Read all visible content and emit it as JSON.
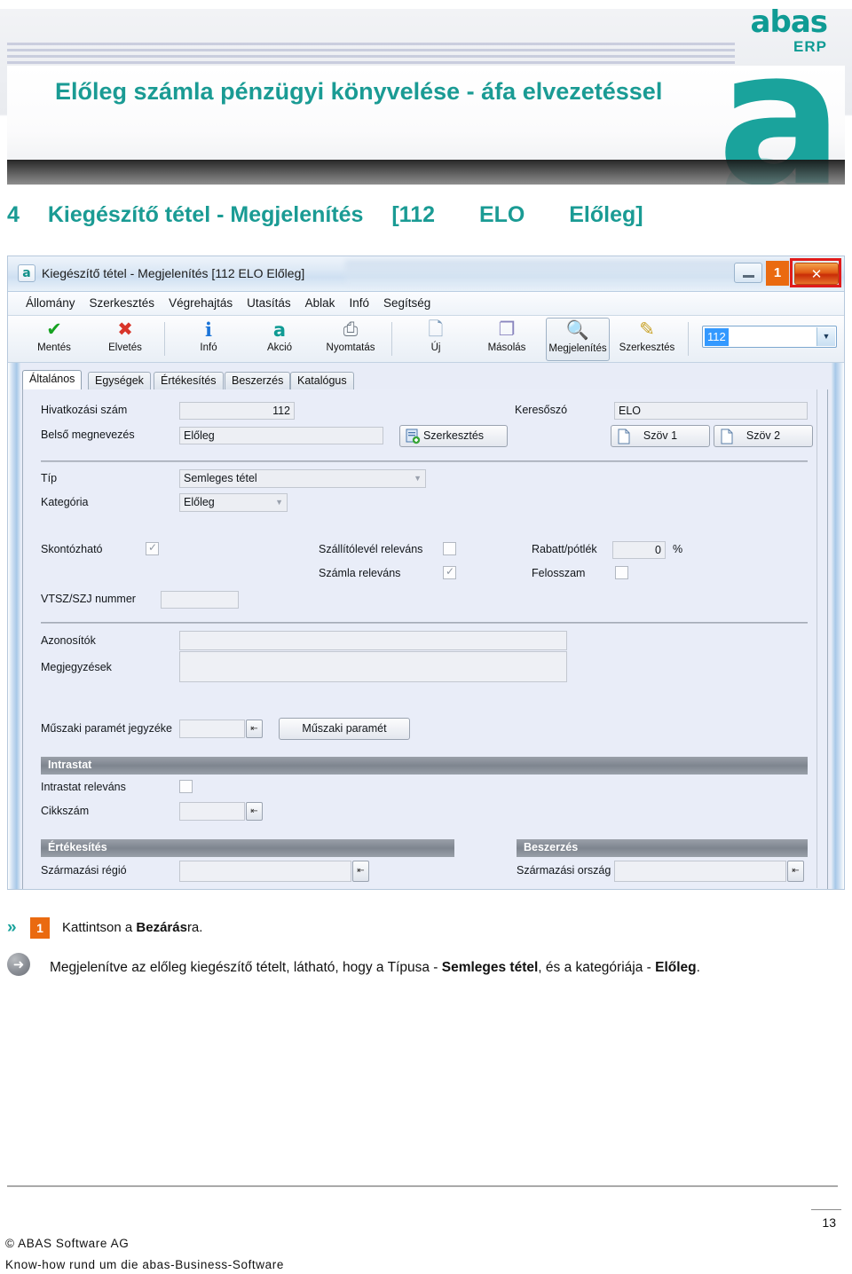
{
  "banner": {
    "logo_word": "abas",
    "logo_sub": "ERP",
    "title": "Előleg számla pénzügyi könyvelése - áfa elvezetéssel",
    "accent_color": "#1a9b94"
  },
  "section": {
    "heading_number": "4",
    "heading_text": "Kiegészítő tétel - Megjelenítés",
    "heading_ref1": "[112",
    "heading_ref2": "ELO",
    "heading_ref3": "Előleg]"
  },
  "window": {
    "title": "Kiegészítő tétel - Megjelenítés [112  ELO  Előleg]",
    "app_icon": "a",
    "minimize_label": "",
    "callout_badge": "1",
    "close_label": "✕",
    "menu": [
      "Állomány",
      "Szerkesztés",
      "Végrehajtás",
      "Utasítás",
      "Ablak",
      "Infó",
      "Segítség"
    ],
    "toolbar": [
      {
        "label": "Mentés",
        "icon": "check-icon",
        "glyph": "✔",
        "color": "#16a221",
        "selected": false
      },
      {
        "label": "Elvetés",
        "icon": "cross-icon",
        "glyph": "✖",
        "color": "#d8352a",
        "selected": false
      },
      {
        "label": "Infó",
        "icon": "info-icon",
        "glyph": "i",
        "color": "#1b74d8",
        "selected": false
      },
      {
        "label": "Akció",
        "icon": "abas-a-icon",
        "glyph": "a",
        "color": "#0f9b94",
        "selected": false
      },
      {
        "label": "Nyomtatás",
        "icon": "printer-icon",
        "glyph": "⎙",
        "color": "#707b86",
        "selected": false
      },
      {
        "label": "Új",
        "icon": "new-doc-icon",
        "glyph": "🗋",
        "color": "#8fa6bd",
        "selected": false
      },
      {
        "label": "Másolás",
        "icon": "copy-icon",
        "glyph": "❐",
        "color": "#8f8fbd",
        "selected": false
      },
      {
        "label": "Megjelenítés",
        "icon": "magnifier-icon",
        "glyph": "🔍",
        "color": "#4a78ad",
        "selected": true
      },
      {
        "label": "Szerkesztés",
        "icon": "edit-pencil-icon",
        "glyph": "✎",
        "color": "#c9a227",
        "selected": false
      }
    ],
    "quick_search_value": "112",
    "tabs": [
      {
        "label": "Általános",
        "active": true
      },
      {
        "label": "Egységek",
        "active": false
      },
      {
        "label": "Értékesítés",
        "active": false
      },
      {
        "label": "Beszerzés",
        "active": false
      },
      {
        "label": "Katalógus",
        "active": false
      }
    ],
    "form": {
      "hivatkozasi_szam_label": "Hivatkozási szám",
      "hivatkozasi_szam_value": "112",
      "belso_megnevezes_label": "Belső megnevezés",
      "belso_megnevezes_value": "Előleg",
      "szerkesztes_button": "Szerkesztés",
      "keresoszo_label": "Keresőszó",
      "keresoszo_value": "ELO",
      "szov1_button": "Szöv 1",
      "szov2_button": "Szöv 2",
      "tip_label": "Típ",
      "tip_value": "Semleges tétel",
      "kategoria_label": "Kategória",
      "kategoria_value": "Előleg",
      "skontozhato_label": "Skontózható",
      "skontozhato_checked": true,
      "szallitolevel_relevans_label": "Szállítólevél releváns",
      "szallitolevel_relevans_checked": false,
      "szamla_relevans_label": "Számla releváns",
      "szamla_relevans_checked": true,
      "rabatt_potlek_label": "Rabatt/pótlék",
      "rabatt_potlek_value": "0",
      "rabatt_potlek_unit": "%",
      "felosszam_label": "Felosszam",
      "felosszam_checked": false,
      "vtsz_label": "VTSZ/SZJ nummer",
      "vtsz_value": "",
      "azonositok_label": "Azonosítók",
      "azonositok_value": "",
      "megjegyzesek_label": "Megjegyzések",
      "megjegyzesek_value": "",
      "muszaki_jegyzek_label": "Műszaki paramét jegyzéke",
      "muszaki_jegyzek_value": "",
      "muszaki_button": "Műszaki paramét",
      "intrastat_group": "Intrastat",
      "intrastat_relevans_label": "Intrastat releváns",
      "intrastat_relevans_checked": false,
      "cikkszam_label": "Cikkszám",
      "cikkszam_value": "",
      "ertekesites_group": "Értékesítés",
      "szarmazasi_regio_label": "Származási régió",
      "szarmazasi_regio_value": "",
      "beszerzes_group": "Beszerzés",
      "szarmazasi_orszag_label": "Származási ország",
      "szarmazasi_orszag_value": ""
    }
  },
  "annotations": {
    "step_badge": "1",
    "step_chevron": "»",
    "step_text_a": "Kattintson  a  ",
    "step_text_b": "Bezárás",
    "step_text_c": "ra.",
    "note_icon": "➜",
    "note_a": "Megjelenítve az előleg kiegészítő tételt, látható, hogy a Típusa - ",
    "note_b": "Semleges tétel",
    "note_c": ", és a kategóriája - ",
    "note_d": "Előleg",
    "note_e": "."
  },
  "footer": {
    "page_number": "13",
    "line1": "© ABAS Software AG",
    "line2": "Know-how rund um die abas-Business-Software"
  }
}
